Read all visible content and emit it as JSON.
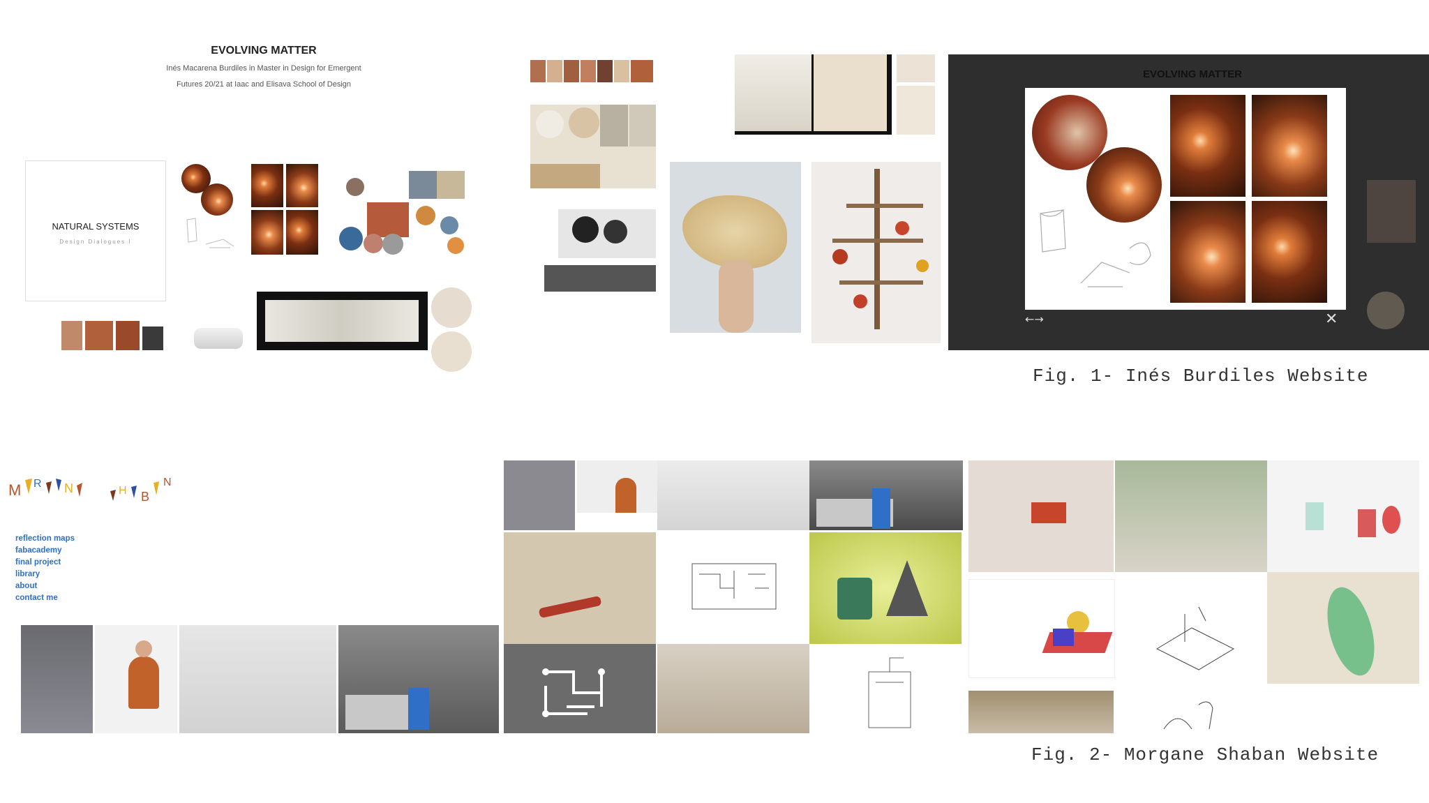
{
  "figure1": {
    "caption": "Fig. 1- Inés Burdiles Website",
    "site_title": "EVOLVING MATTER",
    "subtitle_line1": "Inés Macarena Burdiles in Master in Design for Emergent",
    "subtitle_line2": "Futures 20/21 at Iaac and Elisava School of Design",
    "card_title": "NATURAL SYSTEMS",
    "card_subtitle": "Design Dialogues I",
    "lightbox_title": "EVOLVING MATTER",
    "lightbox_nav": "←→",
    "lightbox_close": "✕",
    "colors": {
      "lightbox_bg": "#2e2e2e",
      "accent": "#b5552a"
    }
  },
  "figure2": {
    "caption": "Fig. 2- Morgane Shaban Website",
    "logo_text": "MORGANE SHABAN",
    "nav": [
      "reflection maps",
      "fabacademy",
      "final project",
      "library",
      "about",
      "contact me"
    ],
    "colors": {
      "nav_link": "#2f6fc7",
      "pcb_bg": "#6b6b6b"
    }
  }
}
